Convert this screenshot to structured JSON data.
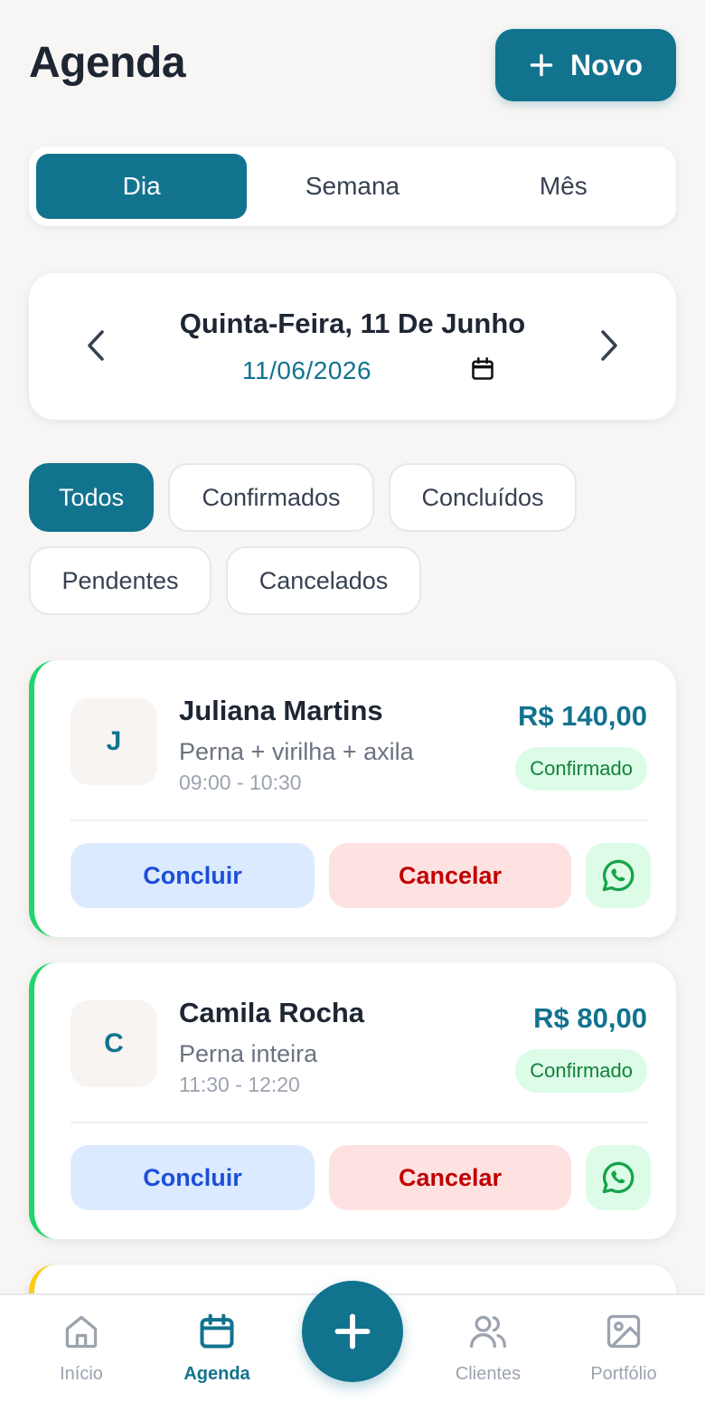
{
  "header": {
    "title": "Agenda",
    "new_button_label": "Novo"
  },
  "view_tabs": [
    {
      "label": "Dia",
      "active": true
    },
    {
      "label": "Semana",
      "active": false
    },
    {
      "label": "Mês",
      "active": false
    }
  ],
  "date_selector": {
    "title": "Quinta-Feira, 11 De Junho",
    "date_value": "11/06/2026"
  },
  "filters": [
    {
      "label": "Todos",
      "active": true
    },
    {
      "label": "Confirmados",
      "active": false
    },
    {
      "label": "Concluídos",
      "active": false
    },
    {
      "label": "Pendentes",
      "active": false
    },
    {
      "label": "Cancelados",
      "active": false
    }
  ],
  "appointments": [
    {
      "initial": "J",
      "client": "Juliana Martins",
      "service": "Perna + virilha + axila",
      "time": "09:00 - 10:30",
      "price": "R$ 140,00",
      "status": "Confirmado",
      "status_color": "#22d46b",
      "conclude_label": "Concluir",
      "cancel_label": "Cancelar"
    },
    {
      "initial": "C",
      "client": "Camila Rocha",
      "service": "Perna inteira",
      "time": "11:30 - 12:20",
      "price": "R$ 80,00",
      "status": "Confirmado",
      "status_color": "#22d46b",
      "conclude_label": "Concluir",
      "cancel_label": "Cancelar"
    }
  ],
  "bottom_nav": {
    "items": [
      {
        "label": "Início",
        "icon": "home-icon",
        "active": false
      },
      {
        "label": "Agenda",
        "icon": "calendar-icon",
        "active": true
      },
      {
        "label": "Clientes",
        "icon": "users-icon",
        "active": false
      },
      {
        "label": "Portfólio",
        "icon": "image-icon",
        "active": false
      }
    ],
    "fab_icon": "plus-icon"
  },
  "colors": {
    "primary": "#12738f",
    "confirmed_accent": "#22d46b",
    "pending_accent": "#facc15"
  }
}
